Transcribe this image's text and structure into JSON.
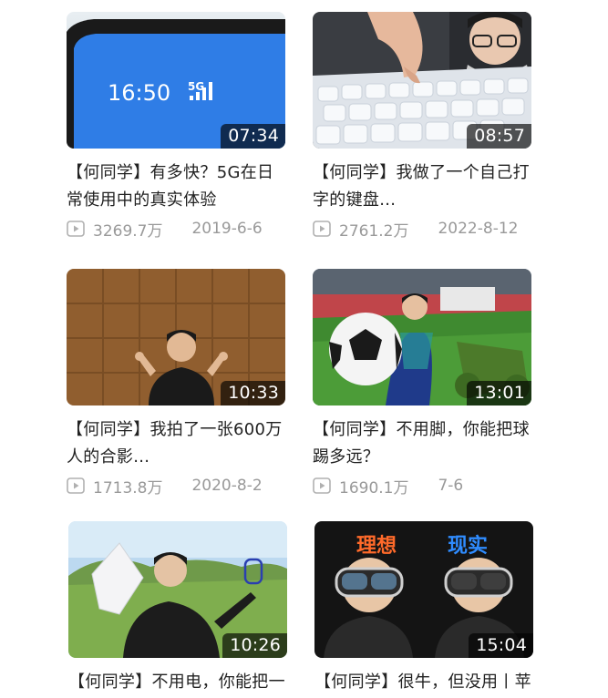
{
  "videos": [
    {
      "duration": "07:34",
      "title": "【何同学】有多快？5G在日常使用中的真实体验",
      "views": "3269.7万",
      "date": "2019-6-6",
      "thumb_text": {
        "time": "16:50",
        "network": "5G"
      }
    },
    {
      "duration": "08:57",
      "title": "【何同学】我做了一个自己打字的键盘...",
      "views": "2761.2万",
      "date": "2022-8-12"
    },
    {
      "duration": "10:33",
      "title": "【何同学】我拍了一张600万人的合影...",
      "views": "1713.8万",
      "date": "2020-8-2"
    },
    {
      "duration": "13:01",
      "title": "【何同学】不用脚，你能把球踢多远？",
      "views": "1690.1万",
      "date": "7-6"
    },
    {
      "duration": "10:26",
      "title": "【何同学】不用电，你能把一",
      "views": "",
      "date": ""
    },
    {
      "duration": "15:04",
      "title": "【何同学】很牛，但没用丨苹",
      "views": "",
      "date": "",
      "thumb_text": {
        "left": "理想",
        "right": "现实"
      }
    }
  ],
  "icons": {
    "views": "play-count-icon"
  },
  "colors": {
    "meta": "#999999",
    "title": "#222222",
    "overlay": "#000000"
  }
}
